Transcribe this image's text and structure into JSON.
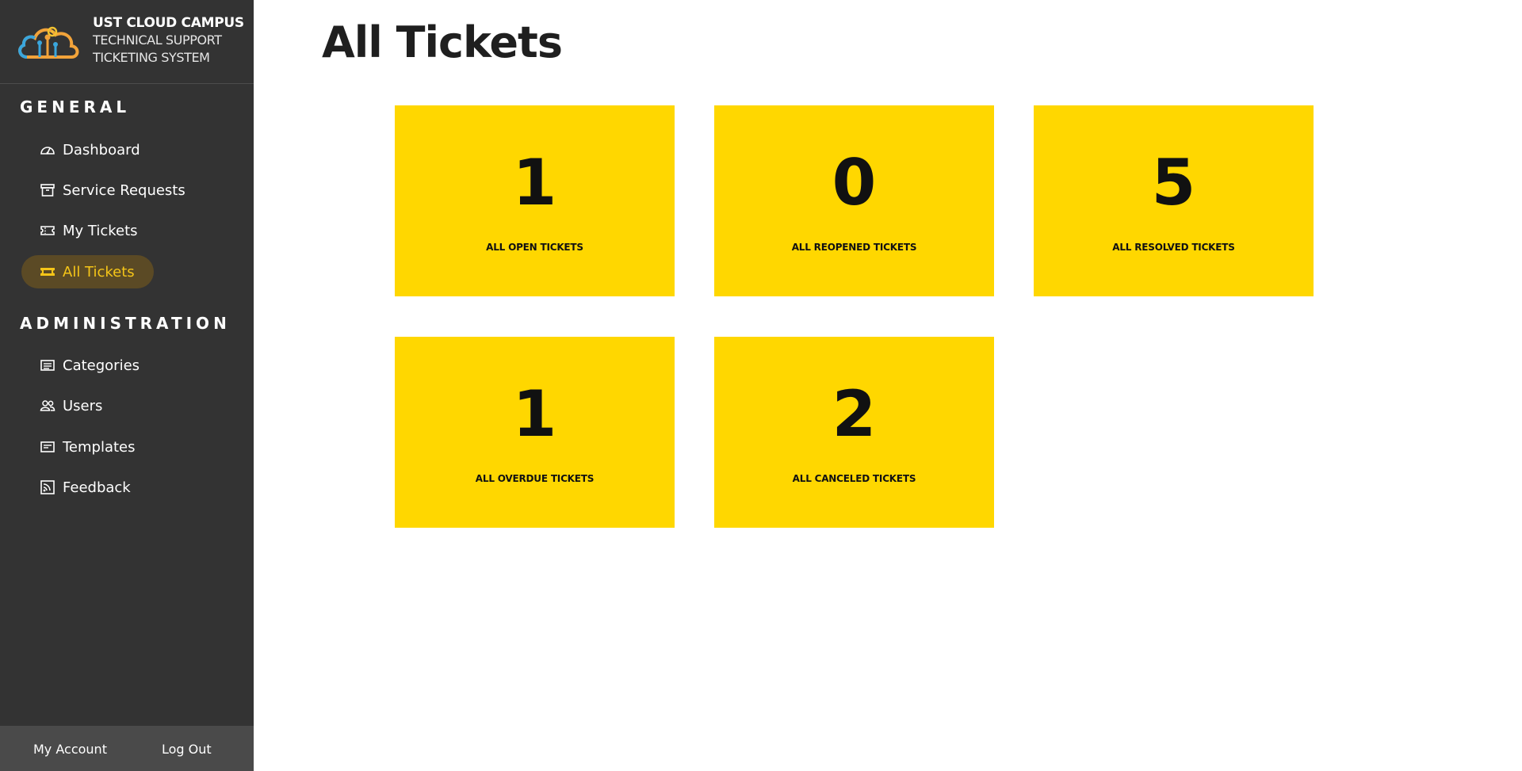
{
  "brand": {
    "title": "UST CLOUD CAMPUS",
    "subtitle_line1": "TECHNICAL SUPPORT",
    "subtitle_line2": "TICKETING SYSTEM"
  },
  "sidebar": {
    "general_heading": "GENERAL",
    "general_items": [
      {
        "label": "Dashboard",
        "icon": "gauge-icon"
      },
      {
        "label": "Service Requests",
        "icon": "archive-icon"
      },
      {
        "label": "My Tickets",
        "icon": "ticket-outline-icon"
      },
      {
        "label": "All Tickets",
        "icon": "ticket-icon",
        "active": true
      }
    ],
    "admin_heading": "ADMINISTRATION",
    "admin_items": [
      {
        "label": "Categories",
        "icon": "list-icon"
      },
      {
        "label": "Users",
        "icon": "users-icon"
      },
      {
        "label": "Templates",
        "icon": "template-icon"
      },
      {
        "label": "Feedback",
        "icon": "rss-icon"
      }
    ],
    "footer": {
      "account_label": "My Account",
      "logout_label": "Log Out"
    }
  },
  "main": {
    "title": "All Tickets",
    "cards": [
      {
        "count": "1",
        "label": "ALL OPEN TICKETS"
      },
      {
        "count": "0",
        "label": "ALL REOPENED TICKETS"
      },
      {
        "count": "5",
        "label": "ALL RESOLVED TICKETS"
      },
      {
        "count": "1",
        "label": "ALL OVERDUE TICKETS"
      },
      {
        "count": "2",
        "label": "ALL CANCELED TICKETS"
      }
    ]
  },
  "colors": {
    "sidebar_bg": "#333333",
    "footer_bg": "#4a4a4a",
    "accent": "#f5c518",
    "active_bg": "#5b4a25",
    "card_bg": "#ffd700"
  }
}
